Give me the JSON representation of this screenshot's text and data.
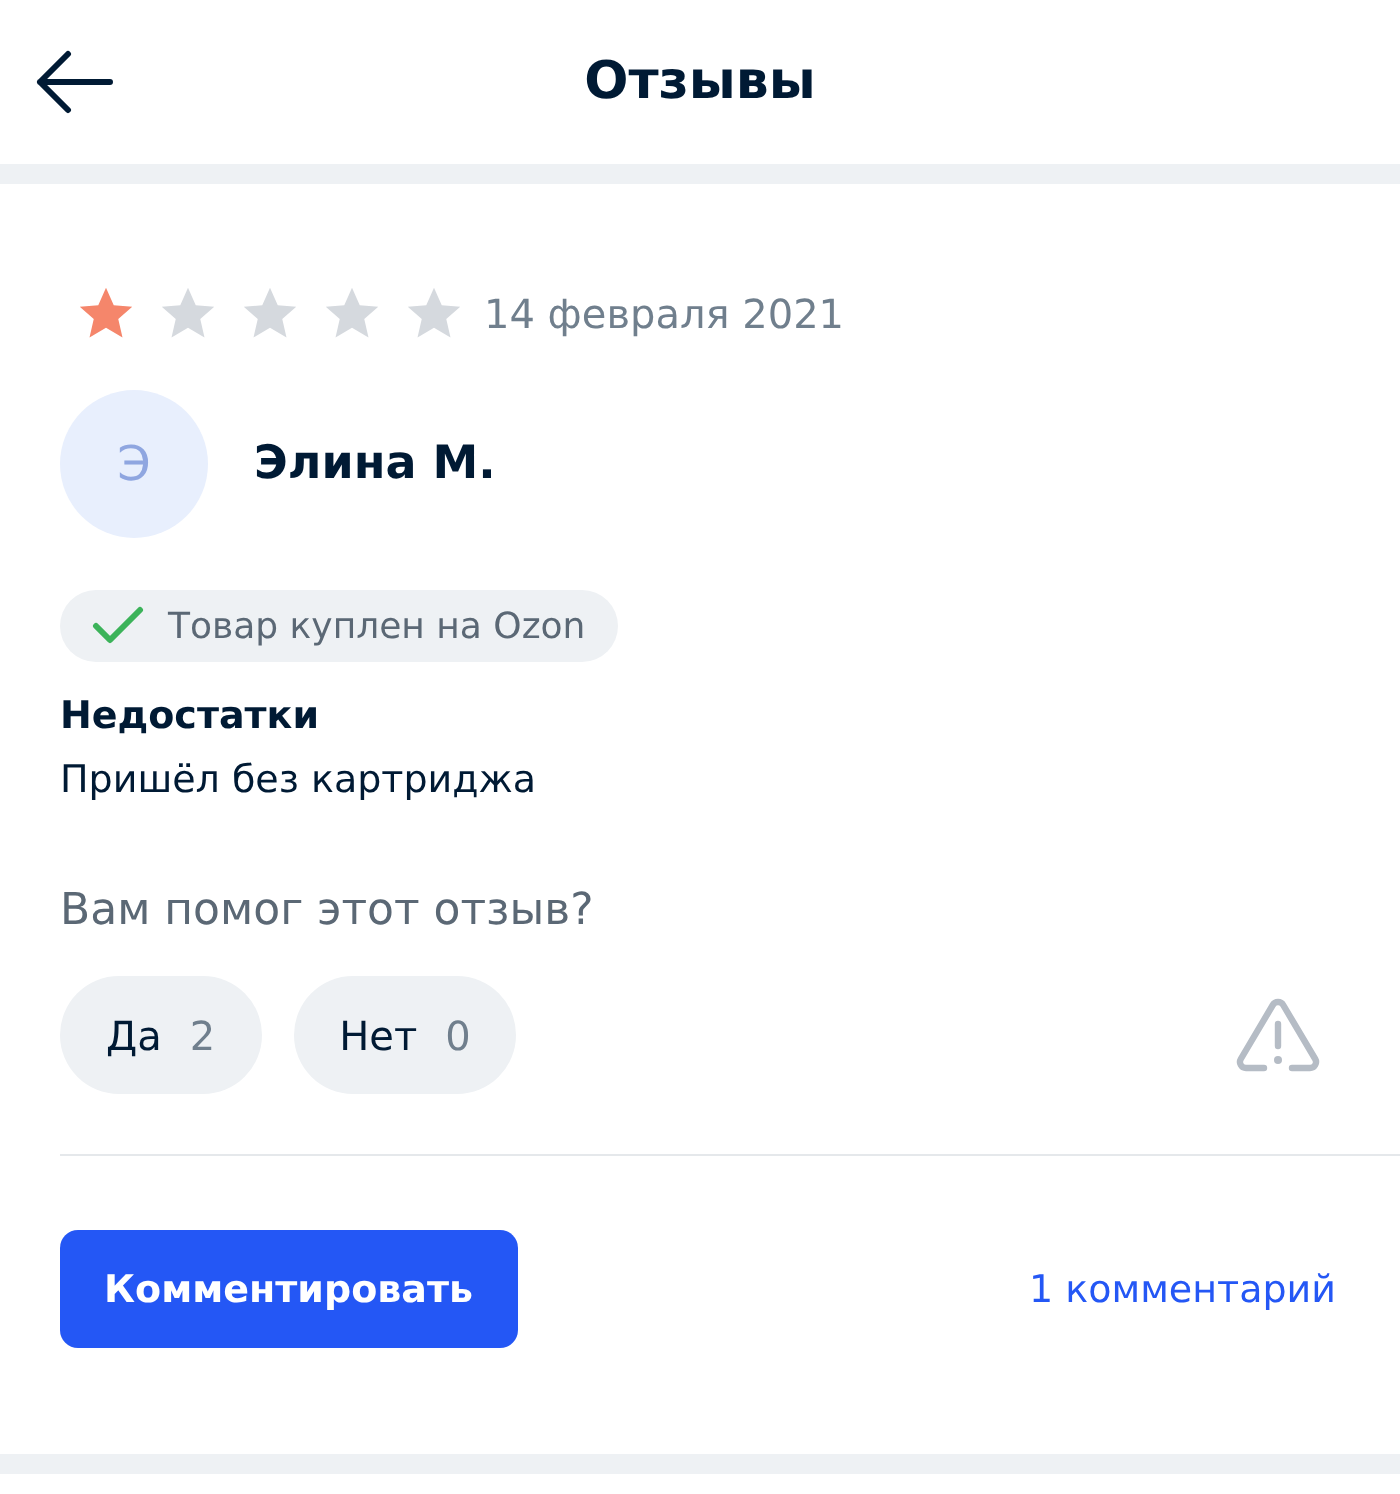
{
  "header": {
    "title": "Отзывы"
  },
  "review": {
    "stars": 1,
    "date": "14 февраля 2021",
    "author": {
      "initial": "Э",
      "name": "Элина М."
    },
    "badge": "Товар куплен на Ozon",
    "sections": [
      {
        "title": "Недостатки",
        "text": "Пришёл без картриджа"
      }
    ],
    "question": "Вам помог этот отзыв?",
    "votes": [
      {
        "label": "Да",
        "count": "2"
      },
      {
        "label": "Нет",
        "count": "0"
      }
    ],
    "comment_button": "Комментировать",
    "comments_link": "1 комментарий"
  }
}
